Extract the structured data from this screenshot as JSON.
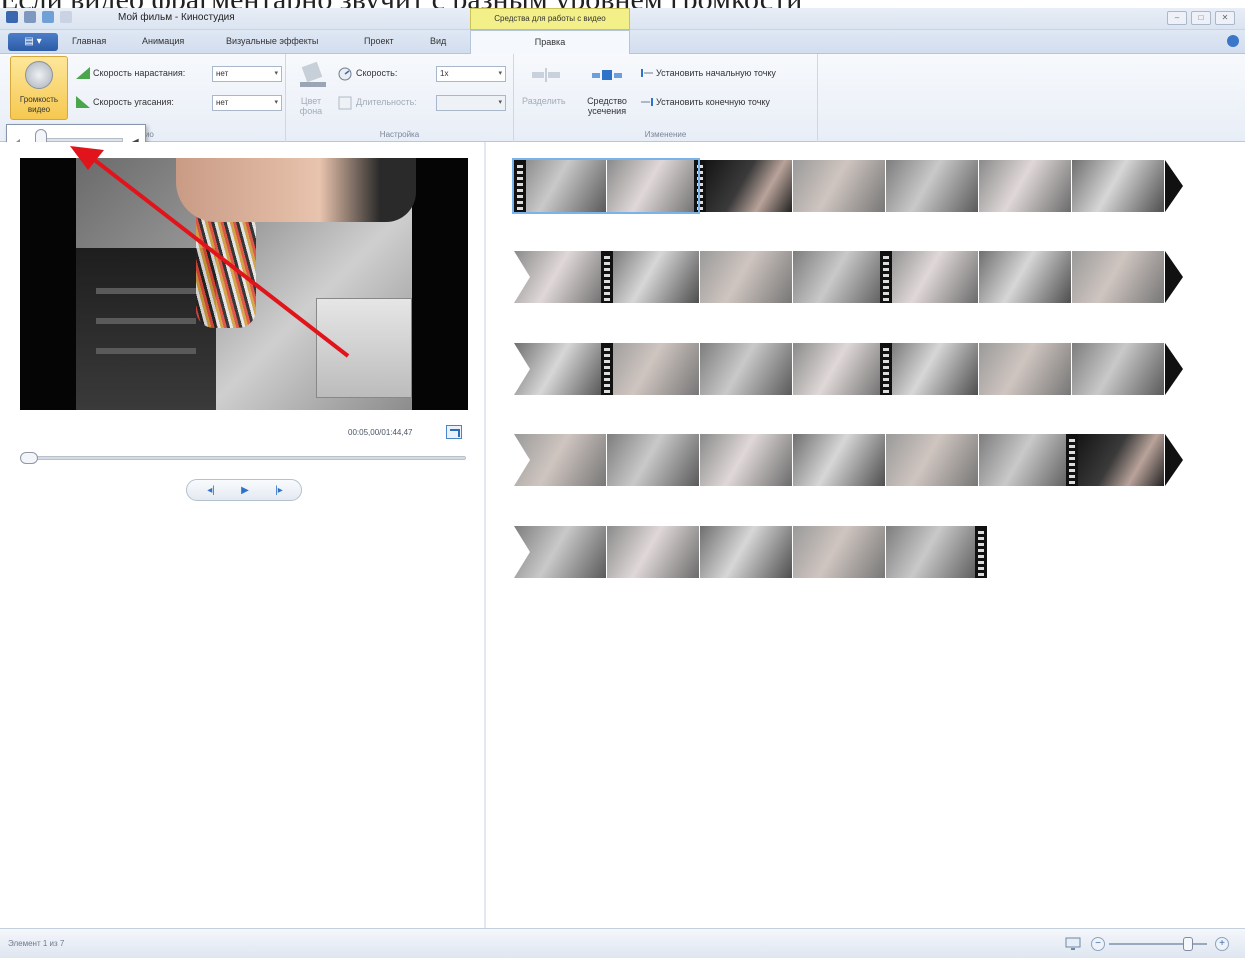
{
  "caption": "Если видео фрагментарно звучит с разным уровнем громкости",
  "window": {
    "title": "Мой фильм - Киностудия",
    "context_tab": "Средства для работы с видео",
    "controls": [
      "–",
      "□",
      "✕"
    ]
  },
  "tabs": {
    "file": "▤ ▾",
    "items": [
      "Главная",
      "Анимация",
      "Визуальные эффекты",
      "Проект",
      "Вид"
    ],
    "active": "Правка"
  },
  "ribbon": {
    "audio": {
      "volume_button": "Громкость видео",
      "fade_in_label": "Скорость нарастания:",
      "fade_in_value": "нет",
      "fade_out_label": "Скорость угасания:",
      "fade_out_value": "нет",
      "group_label": "Аудио"
    },
    "adjust": {
      "bg_color": "Цвет фона",
      "speed_label": "Скорость:",
      "speed_value": "1x",
      "duration_label": "Длительность:",
      "group_label": "Настройка"
    },
    "edit": {
      "split": "Разделить",
      "trim_tool": "Средство усечения",
      "set_start": "Установить начальную точку",
      "set_end": "Установить конечную точку",
      "group_label": "Изменение"
    }
  },
  "preview": {
    "timecode": "00:05,00/01:44,47",
    "playback": {
      "prev": "◂|",
      "play": "▶",
      "next": "|▸"
    }
  },
  "status": {
    "text": "Элемент 1 из 7"
  },
  "colors": {
    "accent": "#2f73c8",
    "annotation": "#e0141a",
    "context_tab": "#f3f08a"
  }
}
